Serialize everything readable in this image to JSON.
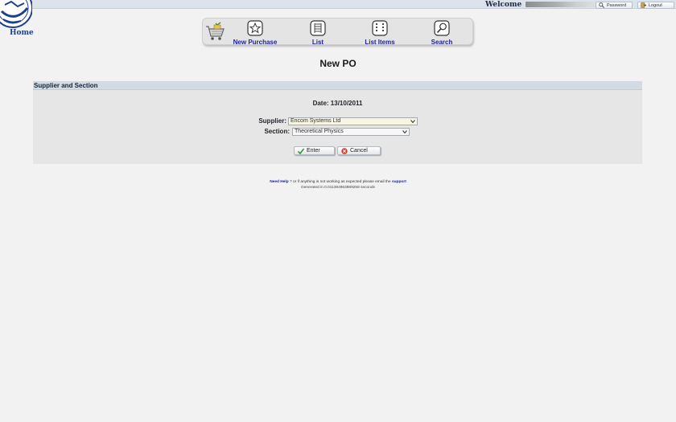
{
  "header": {
    "home_label": "Home",
    "welcome_label": "Welcome",
    "password_label": "Password",
    "logout_label": "Logout"
  },
  "nav": {
    "items": [
      {
        "label": "New Purchase",
        "icon": "star-icon"
      },
      {
        "label": "List",
        "icon": "list-icon"
      },
      {
        "label": "List Items",
        "icon": "list-items-icon"
      },
      {
        "label": "Search",
        "icon": "search-icon"
      }
    ]
  },
  "page": {
    "title": "New PO"
  },
  "panel": {
    "header": "Supplier and Section",
    "date_line": "Date: 13/10/2011",
    "supplier_label": "Supplier:",
    "supplier_value": "Encom Systems Ltd",
    "section_label": "Section:",
    "section_value": "Theoretical Physics",
    "enter_label": "Enter",
    "cancel_label": "Cancel"
  },
  "footer": {
    "need_help_link": "Need Help",
    "help_text_middle": " ? or if anything is not working as expected please email the ",
    "support_link": "support",
    "generated_text": "Generated in 0.011384963989258 seconds"
  },
  "colors": {
    "link": "#22229c",
    "panel_header_bg": "#d2dbe3",
    "panel_bg": "#e6e6e6",
    "supplier_field_bg": "#f7f6e2"
  }
}
